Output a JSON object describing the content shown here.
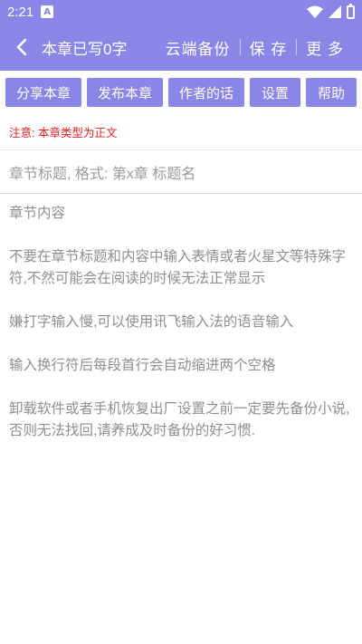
{
  "status_bar": {
    "time": "2:21",
    "app_badge": "A"
  },
  "app_bar": {
    "title": "本章已写0字",
    "actions": [
      "云端备份",
      "保 存",
      "更 多"
    ]
  },
  "toolbar": {
    "buttons": [
      "分享本章",
      "发布本章",
      "作者的话",
      "设置",
      "帮助"
    ]
  },
  "notice": "注意: 本章类型为正文",
  "editor": {
    "title_placeholder": "章节标题, 格式: 第x章 标题名",
    "content_placeholder": [
      "章节内容",
      "不要在章节标题和内容中输入表情或者火星文等特殊字符,不然可能会在阅读的时候无法正常显示",
      "嫌打字输入慢,可以使用讯飞输入法的语音输入",
      "输入换行符后每段首行会自动缩进两个空格",
      "卸载软件或者手机恢复出厂设置之前一定要先备份小说,否则无法找回,请养成及时备份的好习惯."
    ]
  },
  "colors": {
    "primary": "#8a85e6",
    "notice": "#e21f1f",
    "placeholder": "#8f8f8f"
  },
  "icons": {
    "back": "back-arrow-icon",
    "wifi": "wifi-icon",
    "battery": "battery-icon",
    "signal": "signal-icon"
  }
}
